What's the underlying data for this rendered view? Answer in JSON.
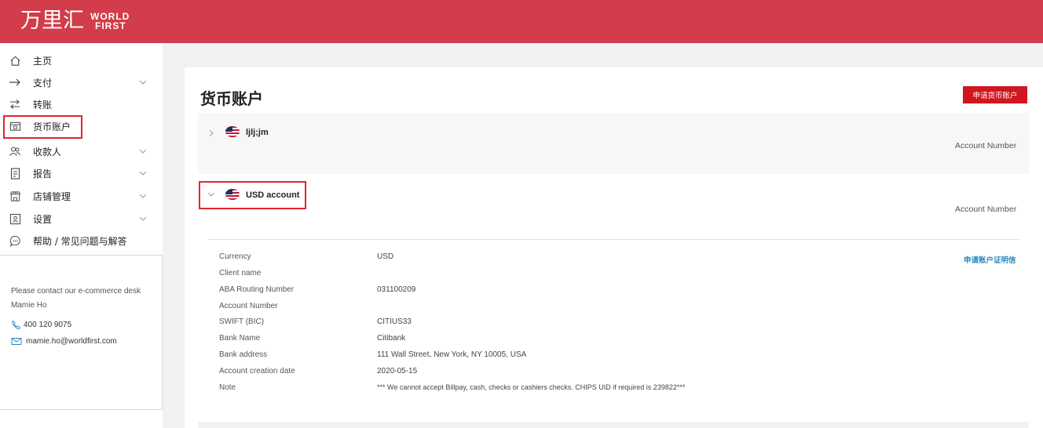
{
  "brand": {
    "cn": "万里汇",
    "en_line1": "WORLD",
    "en_line2": "FIRST",
    "color": "#d33c4a"
  },
  "sidebar": {
    "items": [
      {
        "label": "主页",
        "icon": "home-icon",
        "chevron": false
      },
      {
        "label": "支付",
        "icon": "arrow-right-icon",
        "chevron": true
      },
      {
        "label": "转账",
        "icon": "transfer-icon",
        "chevron": false
      },
      {
        "label": "货币账户",
        "icon": "wallet-icon",
        "chevron": false,
        "active": true
      },
      {
        "label": "收款人",
        "icon": "users-icon",
        "chevron": true
      },
      {
        "label": "报告",
        "icon": "report-icon",
        "chevron": true
      },
      {
        "label": "店铺管理",
        "icon": "store-icon",
        "chevron": true
      },
      {
        "label": "设置",
        "icon": "settings-icon",
        "chevron": true
      },
      {
        "label": "帮助 / 常见问题与解答",
        "icon": "help-icon",
        "chevron": false
      }
    ],
    "contact": {
      "intro": "Please contact our e-commerce desk",
      "name": "Mamie Ho",
      "phone": "400 120 9075",
      "email": "mamie.ho@worldfirst.com"
    }
  },
  "main": {
    "title": "货币账户",
    "apply_button": "申请货币账户",
    "accounts": [
      {
        "name": "ljlj;jm",
        "account_number_label": "Account Number",
        "expanded": false
      },
      {
        "name": "USD account",
        "account_number_label": "Account Number",
        "expanded": true
      }
    ],
    "certificate_link": "申请账户证明信",
    "details": [
      {
        "label": "Currency",
        "value": "USD"
      },
      {
        "label": "Client name",
        "value": ""
      },
      {
        "label": "ABA Routing Number",
        "value": "031100209"
      },
      {
        "label": "Account Number",
        "value": ""
      },
      {
        "label": "SWIFT (BIC)",
        "value": "CITIUS33"
      },
      {
        "label": "Bank Name",
        "value": "Citibank"
      },
      {
        "label": "Bank address",
        "value": "111 Wall Street, New York, NY 10005, USA"
      },
      {
        "label": "Account creation date",
        "value": "2020-05-15"
      },
      {
        "label": "Note",
        "value": "*** We cannot accept Billpay, cash, checks or cashiers checks. CHIPS UID if required is 239822***"
      }
    ]
  },
  "colors": {
    "accent_red": "#d0161f",
    "highlight_red": "#e0262e",
    "link_blue": "#2a8bc0"
  }
}
